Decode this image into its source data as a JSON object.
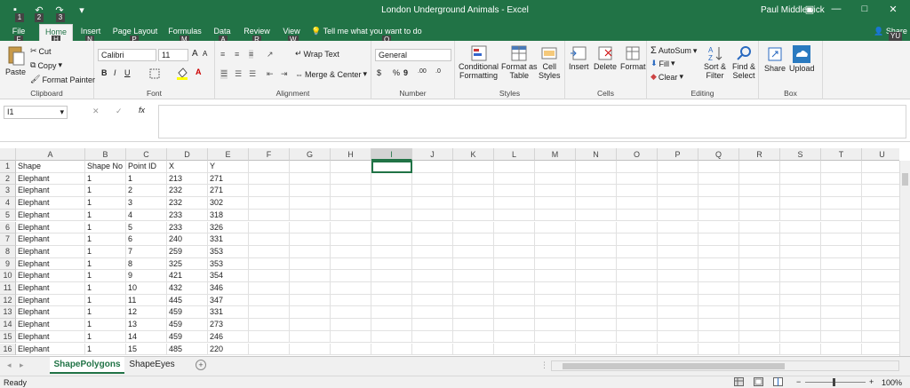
{
  "title_bar": {
    "window_title": "London Underground Animals  -  Excel",
    "user_name": "Paul Middlewick",
    "minimize_glyph": "—",
    "restore_glyph": "▭",
    "maximize_glyph": "□",
    "close_glyph": "✕",
    "save_glyph": "▪",
    "undo_glyph": "↶",
    "redo_glyph": "↷",
    "customize_glyph": "▾",
    "ribbon_options_glyph": "▣",
    "qat_keytips": [
      "1",
      "2",
      "3"
    ],
    "share_keytip": "YU",
    "share_label": "Share"
  },
  "tabs": [
    {
      "label": "File",
      "keytip": "F"
    },
    {
      "label": "Home",
      "keytip": "H"
    },
    {
      "label": "Insert",
      "keytip": "N"
    },
    {
      "label": "Page Layout",
      "keytip": "P"
    },
    {
      "label": "Formulas",
      "keytip": "M"
    },
    {
      "label": "Data",
      "keytip": "A"
    },
    {
      "label": "Review",
      "keytip": "R"
    },
    {
      "label": "View",
      "keytip": "W"
    }
  ],
  "tell_me": {
    "text": "Tell me what you want to do",
    "keytip": "Q"
  },
  "ribbon": {
    "clipboard": {
      "label": "Clipboard",
      "paste": "Paste",
      "cut": "Cut",
      "copy": "Copy",
      "format_painter": "Format Painter"
    },
    "font": {
      "label": "Font",
      "font_name": "Calibri",
      "font_size": "11",
      "grow": "A",
      "shrink": "A",
      "bold": "B",
      "italic": "I",
      "underline": "U",
      "font_color_glyph": "A"
    },
    "alignment": {
      "label": "Alignment",
      "wrap_text": "Wrap Text",
      "merge_center": "Merge & Center"
    },
    "number": {
      "label": "Number",
      "format": "General",
      "currency": "$",
      "percent": "%",
      "comma": "9",
      "inc_decimal": ".00",
      "dec_decimal": ".0"
    },
    "styles": {
      "label": "Styles",
      "conditional_line1": "Conditional",
      "conditional_line2": "Formatting",
      "format_table_line1": "Format as",
      "format_table_line2": "Table",
      "cell_styles_line1": "Cell",
      "cell_styles_line2": "Styles"
    },
    "cells": {
      "label": "Cells",
      "insert": "Insert",
      "delete": "Delete",
      "format": "Format"
    },
    "editing": {
      "label": "Editing",
      "autosum": "AutoSum",
      "fill": "Fill",
      "clear": "Clear",
      "sort_line1": "Sort &",
      "sort_line2": "Filter",
      "find_line1": "Find &",
      "find_line2": "Select"
    },
    "box": {
      "label": "Box",
      "share": "Share",
      "upload": "Upload"
    }
  },
  "formula_bar": {
    "name_box": "I1",
    "fx": "fx",
    "cancel": "✕",
    "enter": "✓",
    "formula": ""
  },
  "grid": {
    "columns": [
      "A",
      "B",
      "C",
      "D",
      "E",
      "F",
      "G",
      "H",
      "I",
      "J",
      "K",
      "L",
      "M",
      "N",
      "O",
      "P",
      "Q",
      "R",
      "S",
      "T",
      "U"
    ],
    "selected_column": "I",
    "rows": [
      {
        "n": "1",
        "cells": [
          "Shape",
          "Shape No",
          "Point ID",
          "X",
          "Y"
        ]
      },
      {
        "n": "2",
        "cells": [
          "Elephant",
          "1",
          "1",
          "213",
          "271"
        ]
      },
      {
        "n": "3",
        "cells": [
          "Elephant",
          "1",
          "2",
          "232",
          "271"
        ]
      },
      {
        "n": "4",
        "cells": [
          "Elephant",
          "1",
          "3",
          "232",
          "302"
        ]
      },
      {
        "n": "5",
        "cells": [
          "Elephant",
          "1",
          "4",
          "233",
          "318"
        ]
      },
      {
        "n": "6",
        "cells": [
          "Elephant",
          "1",
          "5",
          "233",
          "326"
        ]
      },
      {
        "n": "7",
        "cells": [
          "Elephant",
          "1",
          "6",
          "240",
          "331"
        ]
      },
      {
        "n": "8",
        "cells": [
          "Elephant",
          "1",
          "7",
          "259",
          "353"
        ]
      },
      {
        "n": "9",
        "cells": [
          "Elephant",
          "1",
          "8",
          "325",
          "353"
        ]
      },
      {
        "n": "10",
        "cells": [
          "Elephant",
          "1",
          "9",
          "421",
          "354"
        ]
      },
      {
        "n": "11",
        "cells": [
          "Elephant",
          "1",
          "10",
          "432",
          "346"
        ]
      },
      {
        "n": "12",
        "cells": [
          "Elephant",
          "1",
          "11",
          "445",
          "347"
        ]
      },
      {
        "n": "13",
        "cells": [
          "Elephant",
          "1",
          "12",
          "459",
          "331"
        ]
      },
      {
        "n": "14",
        "cells": [
          "Elephant",
          "1",
          "13",
          "459",
          "273"
        ]
      },
      {
        "n": "15",
        "cells": [
          "Elephant",
          "1",
          "14",
          "459",
          "246"
        ]
      },
      {
        "n": "16",
        "cells": [
          "Elephant",
          "1",
          "15",
          "485",
          "220"
        ]
      }
    ]
  },
  "sheets": {
    "tabs": [
      "ShapePolygons",
      "ShapeEyes"
    ],
    "active": "ShapePolygons",
    "add_glyph": "+",
    "prev_glyph": "◂",
    "next_glyph": "▸",
    "more_glyph": "⋮"
  },
  "status": {
    "ready": "Ready",
    "zoom": "100%",
    "zoom_minus": "−",
    "zoom_plus": "+"
  },
  "colors": {
    "accent": "#217346"
  }
}
